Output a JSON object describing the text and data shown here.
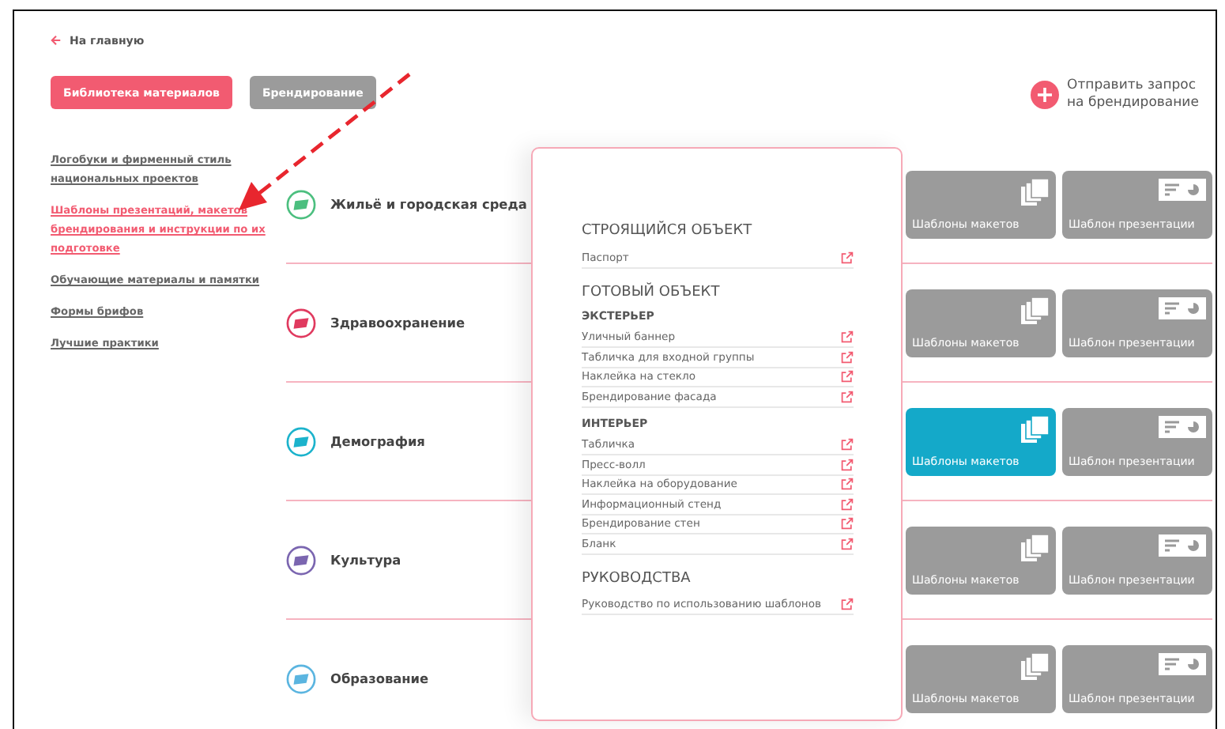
{
  "back_link": {
    "label": "На главную"
  },
  "tabs": [
    {
      "label": "Библиотека материалов",
      "selected": true
    },
    {
      "label": "Брендирование",
      "selected": false
    }
  ],
  "request_button": {
    "label": "Отправить запрос на брендирование"
  },
  "sidebar": {
    "items": [
      {
        "label": "Логобуки и фирменный стиль национальных проектов",
        "selected": false
      },
      {
        "label": "Шаблоны презентаций, макетов брендирования и инструкции по их подготовке",
        "selected": true
      },
      {
        "label": "Обучающие материалы и памятки",
        "selected": false
      },
      {
        "label": "Формы брифов",
        "selected": false
      },
      {
        "label": "Лучшие практики",
        "selected": false
      }
    ]
  },
  "categories": [
    {
      "name": "Жильё и городская среда",
      "color": "#4cbf7f",
      "tiles": [
        {
          "kind": "layouts",
          "label": "Шаблоны макетов",
          "selected": false
        },
        {
          "kind": "presentation",
          "label": "Шаблон презентации",
          "selected": false
        }
      ]
    },
    {
      "name": "Здравоохранение",
      "color": "#e03a5f",
      "tiles": [
        {
          "kind": "layouts",
          "label": "Шаблоны макетов",
          "selected": false
        },
        {
          "kind": "presentation",
          "label": "Шаблон презентации",
          "selected": false
        }
      ]
    },
    {
      "name": "Демография",
      "color": "#1cb3cc",
      "tiles": [
        {
          "kind": "layouts",
          "label": "Шаблоны макетов",
          "selected": true
        },
        {
          "kind": "presentation",
          "label": "Шаблон презентации",
          "selected": false
        }
      ]
    },
    {
      "name": "Культура",
      "color": "#7b66b0",
      "tiles": [
        {
          "kind": "layouts",
          "label": "Шаблоны макетов",
          "selected": false
        },
        {
          "kind": "presentation",
          "label": "Шаблон презентации",
          "selected": false
        }
      ]
    },
    {
      "name": "Образование",
      "color": "#5bb5e0",
      "tiles": [
        {
          "kind": "layouts",
          "label": "Шаблоны макетов",
          "selected": false
        },
        {
          "kind": "presentation",
          "label": "Шаблон презентации",
          "selected": false
        }
      ]
    }
  ],
  "popup": {
    "sections": [
      {
        "title": "СТРОЯЩИЙСЯ ОБЪЕКТ",
        "groups": [
          {
            "items": [
              "Паспорт"
            ]
          }
        ]
      },
      {
        "title": "ГОТОВЫЙ ОБЪЕКТ",
        "groups": [
          {
            "title": "ЭКСТЕРЬЕР",
            "items": [
              "Уличный баннер",
              "Табличка для входной группы",
              "Наклейка на стекло",
              "Брендирование фасада"
            ]
          },
          {
            "title": "ИНТЕРЬЕР",
            "items": [
              "Табличка",
              "Пресс-волл",
              "Наклейка на оборудование",
              "Информационный стенд",
              "Брендирование стен",
              "Бланк"
            ]
          }
        ]
      },
      {
        "title": "РУКОВОДСТВА",
        "groups": [
          {
            "items": [
              "Руководство по использованию шаблонов"
            ]
          }
        ]
      }
    ]
  }
}
